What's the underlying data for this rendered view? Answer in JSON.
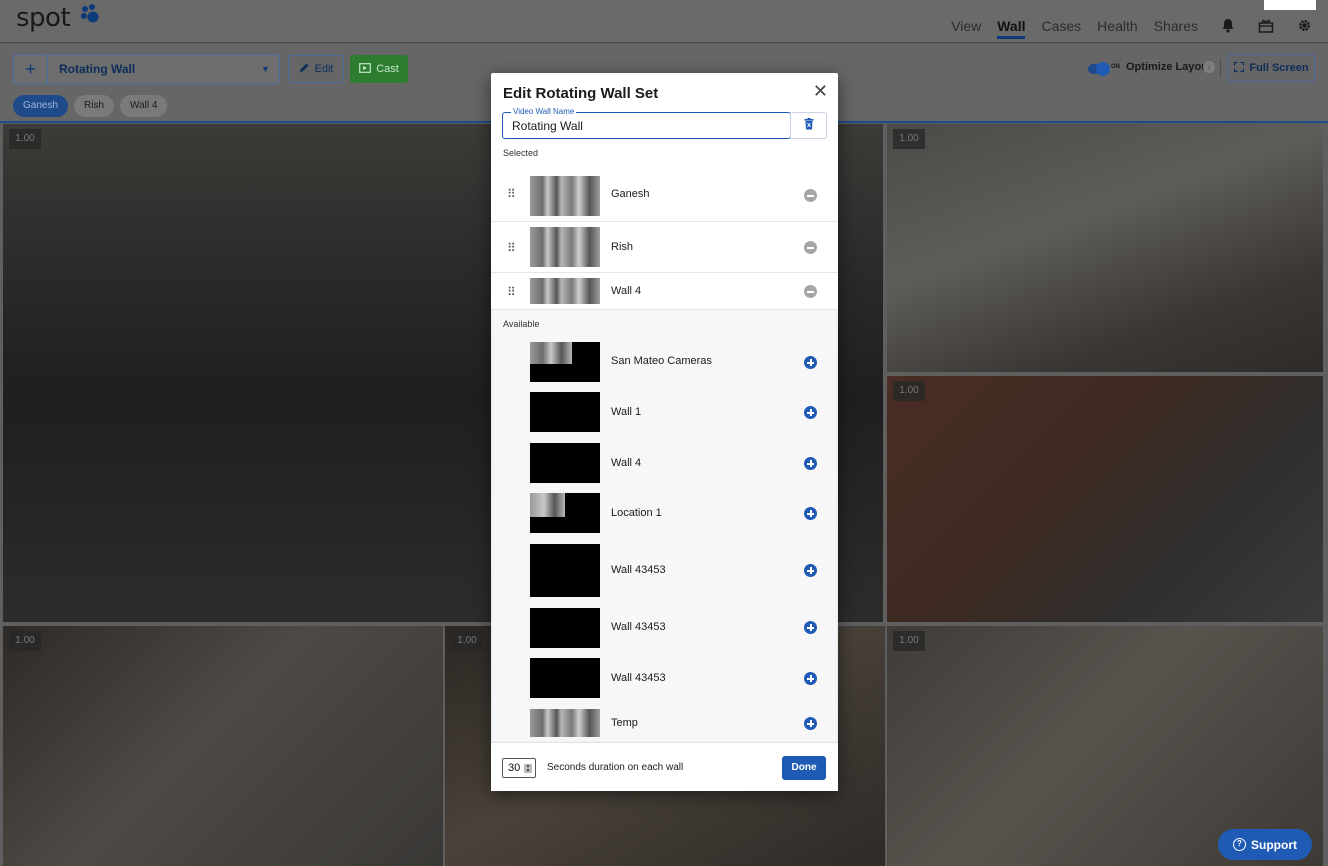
{
  "app": {
    "logo": "spot"
  },
  "nav": {
    "items": [
      "View",
      "Wall",
      "Cases",
      "Health",
      "Shares"
    ],
    "active": "Wall"
  },
  "toolbar": {
    "select_value": "Rotating Wall",
    "edit_label": "Edit",
    "cast_label": "Cast",
    "chips": [
      "Ganesh",
      "Rish",
      "Wall 4"
    ],
    "active_chip": "Ganesh",
    "toggle_on_label": "ON",
    "optimize_label": "Optimize Layout",
    "fullscreen_label": "Full Screen"
  },
  "cameras": {
    "tag": "1.00"
  },
  "modal": {
    "title": "Edit Rotating Wall Set",
    "name_legend": "Video Wall Name",
    "name_value": "Rotating Wall",
    "selected_label": "Selected",
    "available_label": "Available",
    "selected": [
      {
        "name": "Ganesh"
      },
      {
        "name": "Rish"
      },
      {
        "name": "Wall 4"
      }
    ],
    "available": [
      {
        "name": "San Mateo Cameras"
      },
      {
        "name": "Wall 1"
      },
      {
        "name": "Wall 4"
      },
      {
        "name": "Location 1"
      },
      {
        "name": "Wall 43453"
      },
      {
        "name": "Wall 43453"
      },
      {
        "name": "Wall 43453"
      },
      {
        "name": "Temp"
      }
    ],
    "duration_value": "30",
    "duration_label": "Seconds duration on each wall",
    "done_label": "Done"
  },
  "support": {
    "label": "Support"
  },
  "colors": {
    "accent": "#1f5bb5",
    "cast": "#2d7d31",
    "brand_dark": "#0d3a7a"
  }
}
